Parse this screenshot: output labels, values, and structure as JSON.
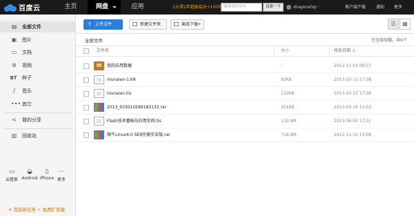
{
  "app": {
    "logo_text": "百度云"
  },
  "topbar": {
    "nav": [
      {
        "label": "主页"
      },
      {
        "label": "网盘"
      },
      {
        "label": "应用"
      }
    ],
    "promo": "1元得1年超级会员+100礼包",
    "search_placeholder": "搜索你的文件",
    "search_button": "百度一下",
    "username": "dragonship···",
    "links": [
      {
        "label": "客户端下载"
      },
      {
        "label": "通知"
      },
      {
        "label": "更多"
      }
    ]
  },
  "sidebar": {
    "items": [
      {
        "label": "全部文件",
        "icon": "all-files-icon"
      },
      {
        "label": "图片",
        "icon": "image-icon"
      },
      {
        "label": "文档",
        "icon": "document-icon"
      },
      {
        "label": "视频",
        "icon": "video-icon"
      },
      {
        "label": "种子",
        "icon": "bt-icon",
        "icon_text": "BT"
      },
      {
        "label": "音乐",
        "icon": "music-icon"
      },
      {
        "label": "其它",
        "icon": "more-dots-icon"
      },
      {
        "label": "我的分享",
        "icon": "share-icon"
      },
      {
        "label": "回收站",
        "icon": "trash-icon"
      }
    ],
    "devices": [
      {
        "label": "云管家",
        "icon": "monitor-icon"
      },
      {
        "label": "Android",
        "icon": "android-icon"
      },
      {
        "label": "iPhone",
        "icon": "iphone-icon"
      },
      {
        "label": "更多",
        "icon": "more-icon"
      }
    ],
    "task_promo": "完成新任务 + 免费扩容量"
  },
  "toolbar": {
    "upload": "上传文件",
    "new_folder": "新建文件夹",
    "offline_download": "离线下载"
  },
  "breadcrumb": "全部文件",
  "loaded_status": "已全部加载，共6个",
  "table": {
    "columns": {
      "name": "文件名",
      "size": "大小",
      "date": "修改日期"
    },
    "rows": [
      {
        "type": "folder",
        "name": "我的应用数据",
        "size": "-",
        "date": "2012-12-03 08:57"
      },
      {
        "type": "doc",
        "name": "niunaian-1.klk",
        "size": "92KB",
        "date": "2013-10-13 17:38"
      },
      {
        "type": "doc",
        "name": "niunaian.tis.",
        "size": "133KB",
        "date": "2013-10-13 17:38"
      },
      {
        "type": "rar",
        "name": "2013_933010289183132.rar",
        "size": "201KB",
        "date": "2013-09-19 11:53"
      },
      {
        "type": "doc",
        "name": "Flash技术基础与应用实例.tis",
        "size": "110.9M",
        "date": "2013-06-02 17:01"
      },
      {
        "type": "rar",
        "name": "限牛Linux4.0 SE8完美中文版.rar",
        "size": "718.8M",
        "date": "2012-11-16 15:08"
      }
    ]
  }
}
